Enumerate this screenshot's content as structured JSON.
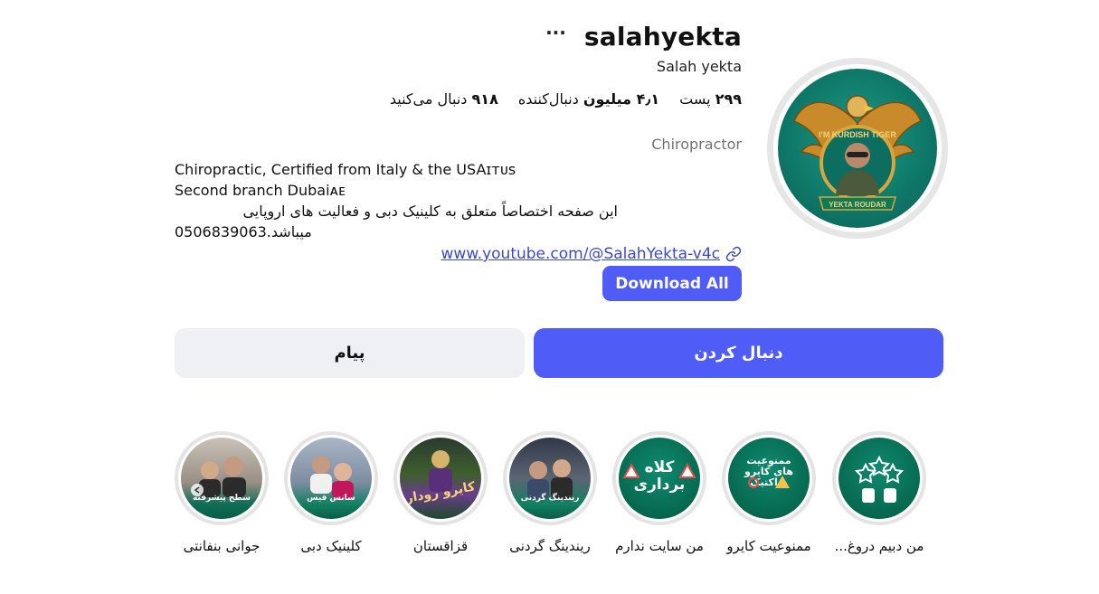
{
  "profile": {
    "username": "salahyekta",
    "more_label": "···",
    "full_name": "Salah yekta",
    "stats": {
      "posts_count": "۲۹۹",
      "posts_label": "پست",
      "followers_count": "۴٫۱ میلیون",
      "followers_label": "دنبال‌کننده",
      "following_count": "۹۱۸",
      "following_label": "دنبال می‌کنید"
    },
    "category": "Chiropractor",
    "bio_line1": "Chiropractic, Certified from Italy & the USAɪᴛᴜs",
    "bio_line2": "Second branch Dubaiᴀᴇ",
    "bio_line3": "این صفحه اختصاصاً متعلق به کلینیک دبی و فعالیت های اروپایی",
    "bio_line4": "0506839063.میباشد",
    "link": "www.youtube.com/@SalahYekta-v4c",
    "link_icon": "link-icon",
    "download_label": "Download All",
    "avatar_text_top": "I'M KURDISH TIGER",
    "avatar_text_bottom": "YEKTA ROUDAR"
  },
  "actions": {
    "message_label": "پیام",
    "follow_label": "دنبال کردن"
  },
  "highlights": [
    {
      "label": "من دبیم دروغ...",
      "caption": "",
      "icon": "stars-hands-icon"
    },
    {
      "label": "ممنوعیت کایرو",
      "caption": "ممنوعیت های کایرو پراکتیک",
      "icon": "warning-icon"
    },
    {
      "label": "من سایت ندارم",
      "caption": "کلاه برداری",
      "icon": "warning-icon"
    },
    {
      "label": "ریندینگ گردنی",
      "caption": "ریندینگ گردنی",
      "icon": ""
    },
    {
      "label": "قزاقستان",
      "caption": "کایرو رودار",
      "icon": ""
    },
    {
      "label": "کلینیک دبی",
      "caption": "سانس فیس",
      "icon": ""
    },
    {
      "label": "جوانی بنفانتی",
      "caption": "سطح پیشرفته",
      "icon": ""
    }
  ],
  "colors": {
    "accent": "#4f5cf6",
    "link": "#3a4ac5",
    "secondary_button": "#eff0f3",
    "muted_text": "#737373",
    "highlight_green": "#06684f"
  }
}
